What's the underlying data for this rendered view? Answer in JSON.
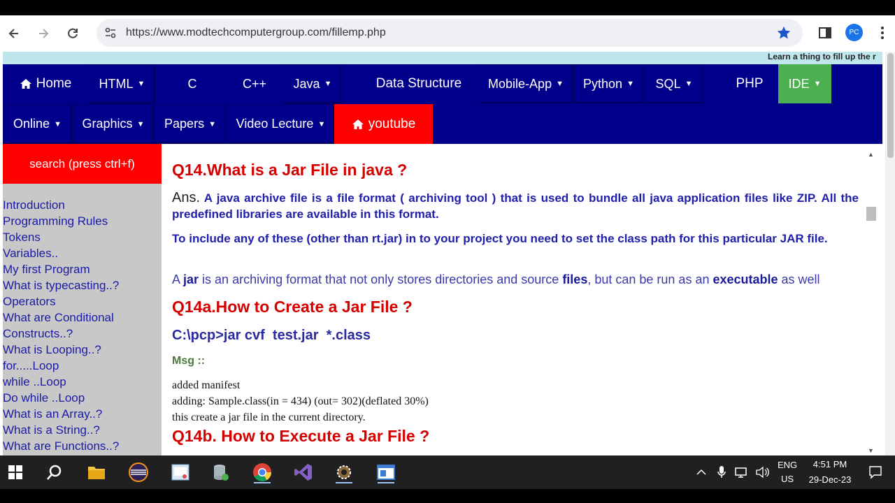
{
  "browser": {
    "url": "https://www.modtechcomputergroup.com/fillemp.php",
    "profile_initials": "PC"
  },
  "marquee": "Learn a thing to fill up the r",
  "nav_row1": [
    {
      "label": "Home",
      "icon": "home-icon"
    },
    {
      "label": "HTML",
      "dropdown": true
    },
    {
      "label": "C"
    },
    {
      "label": "C++"
    },
    {
      "label": "Java",
      "dropdown": true
    },
    {
      "label": "Data Structure"
    },
    {
      "label": "Mobile-App",
      "dropdown": true
    },
    {
      "label": "Python",
      "dropdown": true
    },
    {
      "label": "SQL",
      "dropdown": true
    },
    {
      "label": "PHP"
    },
    {
      "label": "IDE",
      "dropdown": true
    }
  ],
  "nav_row2": [
    {
      "label": "Online",
      "dropdown": true
    },
    {
      "label": "Graphics",
      "dropdown": true
    },
    {
      "label": "Papers",
      "dropdown": true
    },
    {
      "label": "Video Lecture",
      "dropdown": true
    },
    {
      "label": "youtube",
      "icon": "home-icon"
    }
  ],
  "sidebar": {
    "search_label": "search (press ctrl+f)",
    "links": [
      "Introduction",
      "Programming Rules",
      "Tokens",
      "Variables..",
      "My first Program",
      "What is typecasting..?",
      "Operators",
      "What are Conditional",
      "Constructs..?",
      "What is Looping..?",
      "for.....Loop",
      "while ..Loop",
      "Do while ..Loop",
      "What is an Array..?",
      "What is a String..?",
      "What are Functions..?"
    ]
  },
  "content": {
    "q14_title": "Q14.What is a Jar File in java ?",
    "ans_prefix": "Ans.",
    "ans_text": "A java archive file is a file format ( archiving tool ) that is used to bundle all java application files  like ZIP. All the predefined libraries are available in this format.",
    "include_text": "To include any of these (other than rt.jar) in to your project you need to set the class path for this particular JAR file.",
    "jar_desc": {
      "t1": "A ",
      "b1": "jar",
      "t2": " is an archiving format that not only stores directories and source ",
      "b2": "files",
      "t3": ", but can be run as an ",
      "b3": "executable",
      "t4": " as well"
    },
    "q14a_title": "Q14a.How to Create a Jar File ?",
    "command": "C:\\pcp>jar cvf  test.jar  *.class",
    "msg_label": "Msg ::",
    "output_lines": [
      "added manifest",
      "adding: Sample.class(in = 434) (out= 302)(deflated 30%)",
      "this create a jar file in the current directory."
    ],
    "q14b_title": "Q14b. How to Execute a Jar File ?"
  },
  "taskbar": {
    "language": "ENG",
    "region": "US",
    "time": "4:51 PM",
    "date": "29-Dec-23"
  }
}
